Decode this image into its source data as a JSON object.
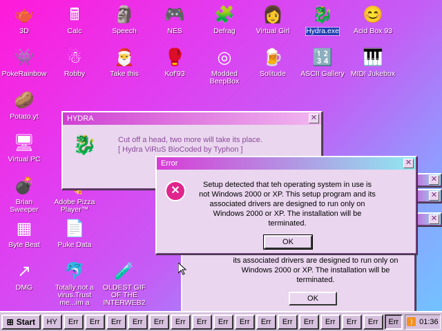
{
  "desktop": {
    "icons": [
      {
        "label": "3D",
        "glyph": "🫖",
        "selected": false
      },
      {
        "label": "Calc",
        "glyph": "🖩",
        "selected": false
      },
      {
        "label": "Speech",
        "glyph": "🗿",
        "selected": false
      },
      {
        "label": "NES",
        "glyph": "🎮",
        "selected": false
      },
      {
        "label": "Defrag",
        "glyph": "🧩",
        "selected": false
      },
      {
        "label": "Virtual Girl",
        "glyph": "👩",
        "selected": false
      },
      {
        "label": "Hydra.exe",
        "glyph": "🐉",
        "selected": true
      },
      {
        "label": "Acid Box 93",
        "glyph": "😊",
        "selected": false
      },
      {
        "label": "PokeRainbow",
        "glyph": "👾",
        "selected": false
      },
      {
        "label": "Robby",
        "glyph": "☃",
        "selected": false
      },
      {
        "label": "Take this",
        "glyph": "🎅",
        "selected": false
      },
      {
        "label": "Kof'93",
        "glyph": "🥊",
        "selected": false
      },
      {
        "label": "Modded BeepBox",
        "glyph": "◎",
        "selected": false
      },
      {
        "label": "Solitude",
        "glyph": "🍺",
        "selected": false
      },
      {
        "label": "ASCII Gallery",
        "glyph": "🔢",
        "selected": false
      },
      {
        "label": "MIDI Jukebox",
        "glyph": "🎹",
        "selected": false
      },
      {
        "label": "Potato.yt",
        "glyph": "🥔",
        "selected": false
      },
      {
        "label": "Virtual PC",
        "glyph": "🖥",
        "selected": false
      },
      {
        "label": "Brian Sweeper",
        "glyph": "💣",
        "selected": false
      },
      {
        "label": "Adobe Pizza Player™",
        "glyph": "🍕",
        "selected": false
      },
      {
        "label": "Byte Beat",
        "glyph": "▦",
        "selected": false
      },
      {
        "label": "Puke Data",
        "glyph": "📄",
        "selected": false
      },
      {
        "label": "DMG",
        "glyph": "↗",
        "selected": false
      },
      {
        "label": "Totally not a virus.Trust me...im a",
        "glyph": "🐬",
        "selected": false
      },
      {
        "label": "OLDEST GIF OF THE INTERWEB2",
        "glyph": "🧪",
        "selected": false
      }
    ]
  },
  "hydra_window": {
    "title": "HYDRA",
    "close": "✕",
    "line1": "Cut off a head, two more will take its place.",
    "line2": "[ Hydra ViRuS BioCoded by Typhon ]"
  },
  "error_window": {
    "title": "Error",
    "close": "✕",
    "icon": "✕",
    "message": "Setup detected that teh operating system in use is not Windows 2000 or XP. This setup program and its associated drivers are designed to run only on Windows 2000 or XP. The installation will be terminated.",
    "ok_label": "OK"
  },
  "back_error_window": {
    "message": "its associated drivers are designed to run only on Windows 2000 or XP. The installation will be terminated.",
    "ok_label": "OK"
  },
  "taskbar": {
    "start_label": "Start",
    "tasks": [
      "HY",
      "Err",
      "Err",
      "Err",
      "Err",
      "Err",
      "Err",
      "Err",
      "Err",
      "Err",
      "Err",
      "Err",
      "Err",
      "Err",
      "Err",
      "Err"
    ],
    "active_task": "Err",
    "clock": "01:36",
    "tray_icon": "rss-icon"
  },
  "colors": {
    "titlebar_start": "#d83bd6",
    "titlebar_end": "#8fe9f0",
    "error_icon": "#e0268c"
  }
}
